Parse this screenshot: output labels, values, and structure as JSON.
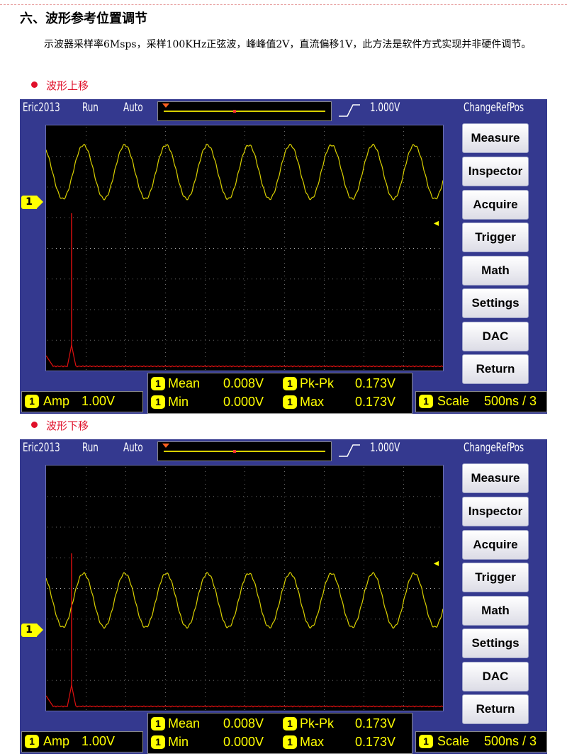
{
  "page": {
    "heading": "六、波形参考位置调节",
    "description": "示波器采样率6Msps，采样100KHz正弦波，峰峰值2V，直流偏移1V，此方法是软件方式实现并非硬件调节。",
    "section_up": "波形上移",
    "section_down": "波形下移"
  },
  "scope": {
    "brand": "Eric2013",
    "run_state": "Run",
    "trigger_mode": "Auto",
    "trigger_level": "1.000V",
    "menu_title": "ChangeRefPos",
    "buttons": [
      "Measure",
      "Inspector",
      "Acquire",
      "Trigger",
      "Math",
      "Settings",
      "DAC",
      "Return"
    ],
    "channel": "1",
    "amp_label": "Amp",
    "amp_value": "1.00V",
    "scale_label": "Scale",
    "scale_value": "500ns / 3",
    "measurements": {
      "mean_label": "Mean",
      "mean_value": "0.008V",
      "pkpk_label": "Pk-Pk",
      "pkpk_value": "0.173V",
      "min_label": "Min",
      "min_value": "0.000V",
      "max_label": "Max",
      "max_value": "0.173V"
    },
    "ref_arrow": "◂",
    "colors": {
      "frame": "#34398f",
      "trace": "#d9d000",
      "fft": "#e01010",
      "marker": "#ffff00"
    }
  },
  "panels": [
    {
      "name": "wave-up",
      "trace_offset": 0.19
    },
    {
      "name": "wave-down",
      "trace_offset": 0.55
    }
  ]
}
